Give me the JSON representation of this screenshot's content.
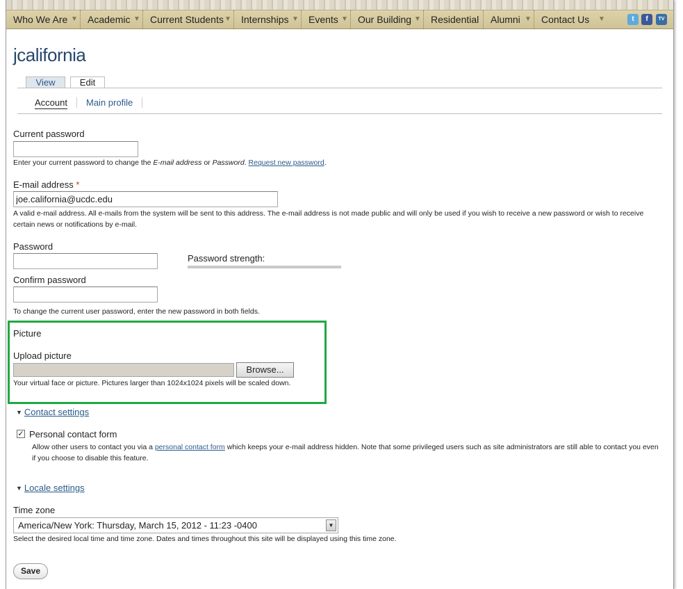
{
  "nav": {
    "items": [
      {
        "label": "Who We Are",
        "has_arrow": true
      },
      {
        "label": "Academic",
        "has_arrow": true
      },
      {
        "label": "Current Students",
        "has_arrow": true
      },
      {
        "label": "Internships",
        "has_arrow": true
      },
      {
        "label": "Events",
        "has_arrow": true
      },
      {
        "label": "Our Building",
        "has_arrow": true
      },
      {
        "label": "Residential",
        "has_arrow": false
      },
      {
        "label": "Alumni",
        "has_arrow": true
      },
      {
        "label": "Contact Us",
        "has_arrow": true
      }
    ],
    "social": [
      {
        "icon": "twitter-icon",
        "glyph": "t",
        "color": "#5ea9dd"
      },
      {
        "icon": "facebook-icon",
        "glyph": "f",
        "color": "#3b5998"
      },
      {
        "icon": "ucdc-tv-icon",
        "glyph": "TV",
        "color": "#3a6ea5"
      }
    ]
  },
  "page": {
    "title": "jcalifornia",
    "tabs": [
      {
        "label": "View",
        "active": false
      },
      {
        "label": "Edit",
        "active": true
      }
    ],
    "subtabs": [
      {
        "label": "Account",
        "active": true
      },
      {
        "label": "Main profile",
        "active": false
      }
    ]
  },
  "form": {
    "current_password": {
      "label": "Current password",
      "value": "",
      "desc_prefix": "Enter your current password to change the ",
      "desc_em1": "E-mail address",
      "desc_mid": " or ",
      "desc_em2": "Password",
      "desc_after": ". ",
      "desc_link": "Request new password",
      "desc_end": "."
    },
    "email": {
      "label": "E-mail address",
      "required_mark": "*",
      "value": "joe.california@ucdc.edu",
      "desc": "A valid e-mail address. All e-mails from the system will be sent to this address. The e-mail address is not made public and will only be used if you wish to receive a new password or wish to receive certain news or notifications by e-mail."
    },
    "password": {
      "label": "Password",
      "value": "",
      "strength_label": "Password strength:"
    },
    "confirm_password": {
      "label": "Confirm password",
      "value": "",
      "desc": "To change the current user password, enter the new password in both fields."
    },
    "picture": {
      "section_label": "Picture",
      "upload_label": "Upload picture",
      "browse_label": "Browse...",
      "desc": "Your virtual face or picture. Pictures larger than 1024x1024 pixels will be scaled down.",
      "highlight_color": "#20a843"
    },
    "contact_settings": {
      "legend": "Contact settings",
      "checkbox_label": "Personal contact form",
      "checked": true,
      "check_glyph": "✓",
      "desc_prefix": "Allow other users to contact you via a ",
      "desc_link": "personal contact form",
      "desc_suffix": " which keeps your e-mail address hidden. Note that some privileged users such as site administrators are still able to contact you even if you choose to disable this feature."
    },
    "locale_settings": {
      "legend": "Locale settings",
      "timezone_label": "Time zone",
      "timezone_value": "America/New York: Thursday, March 15, 2012 - 11:23 -0400",
      "timezone_desc": "Select the desired local time and time zone. Dates and times throughout this site will be displayed using this time zone."
    },
    "save_label": "Save"
  },
  "colors": {
    "title": "#27476e",
    "link": "#2a5b8a",
    "nav_bg": "#d8cda3"
  }
}
